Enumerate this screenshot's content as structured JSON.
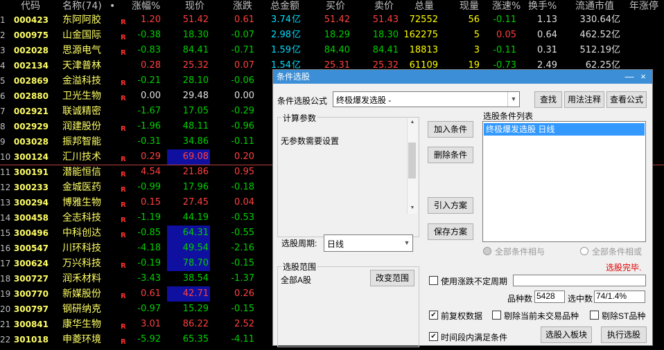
{
  "headers": [
    "代码",
    "名称(74)",
    "•",
    "涨幅%",
    "现价",
    "涨跌",
    "总金额",
    "买价",
    "卖价",
    "总量",
    "现量",
    "涨速%",
    "换手%",
    "流通市值",
    "年涨停"
  ],
  "rows": [
    {
      "i": "1",
      "code": "000423",
      "name": "东阿阿胶",
      "r": "R",
      "pct": "1.20",
      "price": "51.42",
      "chg": "0.61",
      "amt": "3.74",
      "unit": "亿",
      "bid": "51.42",
      "ask": "51.43",
      "vol": "72552",
      "cur": "56",
      "spd": "-0.11",
      "turn": "1.13",
      "cap": "330.64亿",
      "dir": "up"
    },
    {
      "i": "2",
      "code": "000975",
      "name": "山金国际",
      "r": "R",
      "pct": "-0.38",
      "price": "18.30",
      "chg": "-0.07",
      "amt": "2.98",
      "unit": "亿",
      "bid": "18.29",
      "ask": "18.30",
      "vol": "162275",
      "cur": "5",
      "spd": "0.05",
      "turn": "0.64",
      "cap": "462.52亿",
      "dir": "down"
    },
    {
      "i": "3",
      "code": "002028",
      "name": "思源电气",
      "r": "R",
      "pct": "-0.83",
      "price": "84.41",
      "chg": "-0.71",
      "amt": "1.59",
      "unit": "亿",
      "bid": "84.40",
      "ask": "84.41",
      "vol": "18813",
      "cur": "3",
      "spd": "-0.11",
      "turn": "0.31",
      "cap": "512.19亿",
      "dir": "down"
    },
    {
      "i": "4",
      "code": "002134",
      "name": "天津普林",
      "r": "",
      "pct": "0.28",
      "price": "25.32",
      "chg": "0.07",
      "amt": "1.54",
      "unit": "亿",
      "bid": "25.31",
      "ask": "25.32",
      "vol": "61109",
      "cur": "19",
      "spd": "-0.73",
      "turn": "2.49",
      "cap": "62.25亿",
      "dir": "up"
    },
    {
      "i": "5",
      "code": "002869",
      "name": "金溢科技",
      "r": "R",
      "pct": "-0.21",
      "price": "28.10",
      "chg": "-0.06",
      "dir": "down"
    },
    {
      "i": "6",
      "code": "002880",
      "name": "卫光生物",
      "r": "R",
      "pct": "0.00",
      "price": "29.48",
      "chg": "0.00",
      "dir": "flat"
    },
    {
      "i": "7",
      "code": "002921",
      "name": "联诚精密",
      "r": "",
      "pct": "-1.67",
      "price": "17.05",
      "chg": "-0.29",
      "dir": "down"
    },
    {
      "i": "8",
      "code": "002929",
      "name": "润建股份",
      "r": "R",
      "pct": "-1.96",
      "price": "48.11",
      "chg": "-0.96",
      "dir": "down"
    },
    {
      "i": "9",
      "code": "003028",
      "name": "振邦智能",
      "r": "",
      "pct": "-0.31",
      "price": "34.86",
      "chg": "-0.11",
      "dir": "down"
    },
    {
      "i": "10",
      "code": "300124",
      "name": "汇川技术",
      "r": "R",
      "pct": "0.29",
      "price": "69.08",
      "chg": "0.20",
      "dir": "up",
      "hl": true
    },
    {
      "i": "11",
      "code": "300191",
      "name": "潜能恒信",
      "r": "R",
      "pct": "4.54",
      "price": "21.86",
      "chg": "0.95",
      "dir": "up"
    },
    {
      "i": "12",
      "code": "300233",
      "name": "金城医药",
      "r": "R",
      "pct": "-0.99",
      "price": "17.96",
      "chg": "-0.18",
      "dir": "down"
    },
    {
      "i": "13",
      "code": "300294",
      "name": "博雅生物",
      "r": "R",
      "pct": "0.15",
      "price": "27.45",
      "chg": "0.04",
      "dir": "up"
    },
    {
      "i": "14",
      "code": "300458",
      "name": "全志科技",
      "r": "R",
      "pct": "-1.19",
      "price": "44.19",
      "chg": "-0.53",
      "dir": "down"
    },
    {
      "i": "15",
      "code": "300496",
      "name": "中科创达",
      "r": "R",
      "pct": "-0.85",
      "price": "64.31",
      "chg": "-0.55",
      "dir": "down",
      "hl": true
    },
    {
      "i": "16",
      "code": "300547",
      "name": "川环科技",
      "r": "",
      "pct": "-4.18",
      "price": "49.54",
      "chg": "-2.16",
      "dir": "down",
      "hl": true
    },
    {
      "i": "17",
      "code": "300624",
      "name": "万兴科技",
      "r": "R",
      "pct": "-0.19",
      "price": "78.70",
      "chg": "-0.15",
      "dir": "down",
      "hl": true
    },
    {
      "i": "18",
      "code": "300727",
      "name": "润禾材料",
      "r": "",
      "pct": "-3.43",
      "price": "38.54",
      "chg": "-1.37",
      "dir": "down"
    },
    {
      "i": "19",
      "code": "300770",
      "name": "新媒股份",
      "r": "R",
      "pct": "0.61",
      "price": "42.71",
      "chg": "0.26",
      "dir": "up",
      "hl": true
    },
    {
      "i": "20",
      "code": "300797",
      "name": "钢研纳克",
      "r": "",
      "pct": "-0.97",
      "price": "15.29",
      "chg": "-0.15",
      "dir": "down"
    },
    {
      "i": "21",
      "code": "300841",
      "name": "康华生物",
      "r": "R",
      "pct": "3.01",
      "price": "86.22",
      "chg": "2.52",
      "dir": "up"
    },
    {
      "i": "22",
      "code": "301018",
      "name": "申菱环境",
      "r": "R",
      "pct": "-5.92",
      "price": "65.35",
      "chg": "-4.11",
      "dir": "down"
    }
  ],
  "dialog": {
    "title": "条件选股",
    "close": "×",
    "minimize": "—",
    "formula_label": "条件选股公式",
    "formula_value": "终极爆发选股  -",
    "find": "查找",
    "usage": "用法注释",
    "view": "查看公式",
    "params_title": "计算参数",
    "params_text": "无参数需要设置",
    "add": "加入条件",
    "delete": "删除条件",
    "import": "引入方案",
    "save": "保存方案",
    "list_title": "选股条件列表",
    "list_item": "终极爆发选股  日线",
    "period_label": "选股周期:",
    "period_value": "日线",
    "radio_and": "全部条件相与",
    "radio_or": "全部条件相或",
    "status": "选股完毕.",
    "range_title": "选股范围",
    "range_value": "全部A股",
    "range_btn": "改变范围",
    "variable_period": "使用涨跌不定周期",
    "count_label": "品种数",
    "count_value": "5428",
    "selected_label": "选中数",
    "selected_value": "74/1.4%",
    "pre_adjust": "前复权数据",
    "exclude_untraded": "剔除当前未交易品种",
    "exclude_st": "剔除ST品种",
    "add_block": "选股入板块",
    "execute": "执行选股",
    "time_cond": "时间段内满足条件",
    "check": "✔"
  }
}
